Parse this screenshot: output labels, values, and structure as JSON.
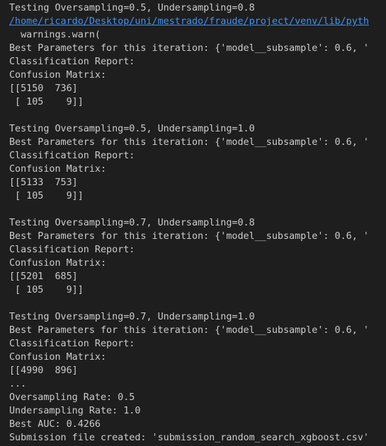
{
  "terminal": {
    "lines": [
      {
        "text": "Testing Oversampling=0.5, Undersampling=0.8"
      },
      {
        "text": "/home/ricardo/Desktop/uni/mestrado/fraude/project/venv/lib/pyth",
        "link": true
      },
      {
        "text": "  warnings.warn("
      },
      {
        "text": "Best Parameters for this iteration: {'model__subsample': 0.6, '"
      },
      {
        "text": "Classification Report:"
      },
      {
        "text": "Confusion Matrix:"
      },
      {
        "text": "[[5150  736]"
      },
      {
        "text": " [ 105    9]]"
      },
      {
        "text": ""
      },
      {
        "text": "Testing Oversampling=0.5, Undersampling=1.0"
      },
      {
        "text": "Best Parameters for this iteration: {'model__subsample': 0.6, '"
      },
      {
        "text": "Classification Report:"
      },
      {
        "text": "Confusion Matrix:"
      },
      {
        "text": "[[5133  753]"
      },
      {
        "text": " [ 105    9]]"
      },
      {
        "text": ""
      },
      {
        "text": "Testing Oversampling=0.7, Undersampling=0.8"
      },
      {
        "text": "Best Parameters for this iteration: {'model__subsample': 0.6, '"
      },
      {
        "text": "Classification Report:"
      },
      {
        "text": "Confusion Matrix:"
      },
      {
        "text": "[[5201  685]"
      },
      {
        "text": " [ 105    9]]"
      },
      {
        "text": ""
      },
      {
        "text": "Testing Oversampling=0.7, Undersampling=1.0"
      },
      {
        "text": "Best Parameters for this iteration: {'model__subsample': 0.6, '"
      },
      {
        "text": "Classification Report:"
      },
      {
        "text": "Confusion Matrix:"
      },
      {
        "text": "[[4990  896]"
      },
      {
        "text": "..."
      },
      {
        "text": "Oversampling Rate: 0.5"
      },
      {
        "text": "Undersampling Rate: 1.0"
      },
      {
        "text": "Best AUC: 0.4266"
      },
      {
        "text": "Submission file created: 'submission_random_search_xgboost.csv'"
      }
    ]
  }
}
